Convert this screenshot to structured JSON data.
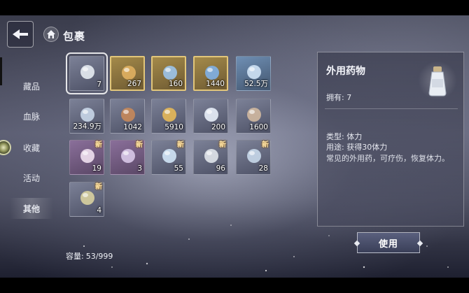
{
  "header": {
    "title": "包裹"
  },
  "sidebar": {
    "items": [
      {
        "label": "藏品"
      },
      {
        "label": "血脉"
      },
      {
        "label": "收藏"
      },
      {
        "label": "活动"
      },
      {
        "label": "其他"
      }
    ],
    "active_index": 4
  },
  "new_label": "新",
  "inventory": {
    "items": [
      {
        "qty": "7",
        "rarity": "grey",
        "icon": "medicine-bottle-icon",
        "selected": true
      },
      {
        "qty": "267",
        "rarity": "gold",
        "icon": "gold-shard-icon"
      },
      {
        "qty": "160",
        "rarity": "gold",
        "icon": "blue-crystal-icon"
      },
      {
        "qty": "1440",
        "rarity": "gold",
        "icon": "blue-ore-icon"
      },
      {
        "qty": "52.5万",
        "rarity": "blue",
        "icon": "water-drop-icon"
      },
      {
        "qty": "234.9万",
        "rarity": "grey",
        "icon": "silver-coin-icon"
      },
      {
        "qty": "1042",
        "rarity": "grey",
        "icon": "bronze-orb-icon"
      },
      {
        "qty": "5910",
        "rarity": "grey",
        "icon": "golden-fragment-icon"
      },
      {
        "qty": "200",
        "rarity": "grey",
        "icon": "pearl-orb-icon"
      },
      {
        "qty": "1600",
        "rarity": "grey",
        "icon": "film-scroll-icon"
      },
      {
        "qty": "19",
        "rarity": "purple",
        "icon": "glowing-sphere-icon",
        "new": true
      },
      {
        "qty": "3",
        "rarity": "purple",
        "icon": "violet-sphere-icon",
        "new": true
      },
      {
        "qty": "55",
        "rarity": "grey",
        "icon": "crystal-sphere-icon",
        "new": true
      },
      {
        "qty": "96",
        "rarity": "grey",
        "icon": "stone-block-icon",
        "new": true
      },
      {
        "qty": "28",
        "rarity": "grey",
        "icon": "ticket-icon",
        "new": true
      },
      {
        "qty": "4",
        "rarity": "grey",
        "icon": "feather-quill-icon",
        "new": true
      }
    ]
  },
  "capacity": {
    "label": "容量:",
    "value": "53/999"
  },
  "detail": {
    "title": "外用药物",
    "owned": "拥有: 7",
    "type": "类型: 体力",
    "usage": "用途: 获得30体力",
    "description": "常见的外用药，可疗伤，恢复体力。",
    "icon": "medicine-bottle-icon"
  },
  "use_button": {
    "label": "使用"
  }
}
